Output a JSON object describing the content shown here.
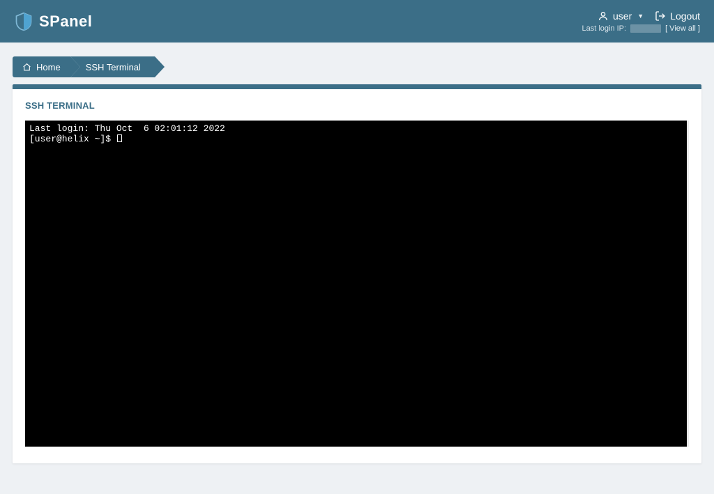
{
  "brand": {
    "name": "SPanel"
  },
  "header": {
    "username": "user",
    "logout": "Logout",
    "last_login_label": "Last login IP:",
    "view_all": "[ View all ]"
  },
  "breadcrumbs": {
    "home": "Home",
    "current": "SSH Terminal"
  },
  "panel": {
    "title": "SSH TERMINAL"
  },
  "terminal": {
    "line1": "Last login: Thu Oct  6 02:01:12 2022",
    "prompt": "[user@helix ~]$ "
  }
}
